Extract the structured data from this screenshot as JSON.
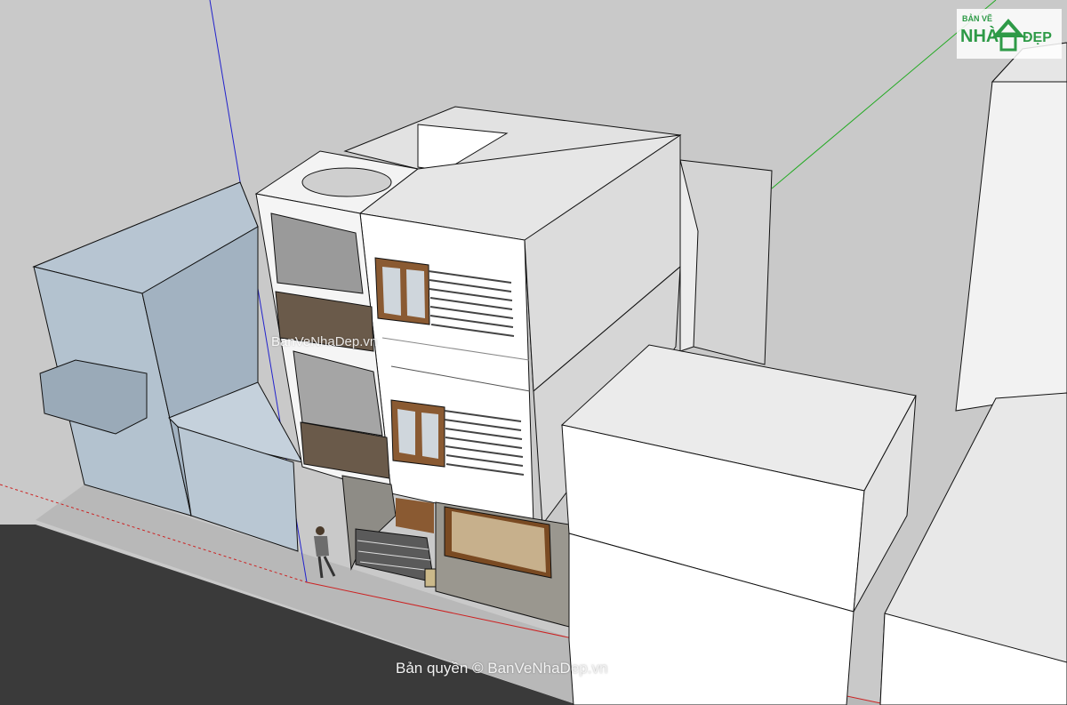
{
  "watermarks": {
    "center": "BanVeNhaDep.vn",
    "bottom": "Bản quyền © BanVeNhaDep.vn"
  },
  "logo": {
    "text_top": "BẢN VẼ",
    "text_nha": "NHÀ",
    "text_dep": "ĐẸP"
  },
  "colors": {
    "sky": "#c9c9c9",
    "road": "#3a3a3a",
    "sidewalk": "#b7b7b7",
    "wall_white": "#ffffff",
    "wall_grey": "#d9d9d9",
    "neighbor_blue": "#b3c2cf",
    "wood": "#7a4a22",
    "stone": "#8e8c86",
    "axis_blue": "#2222cc",
    "axis_green": "#22aa22",
    "axis_red": "#cc2222",
    "logo_green": "#2e9a47"
  }
}
